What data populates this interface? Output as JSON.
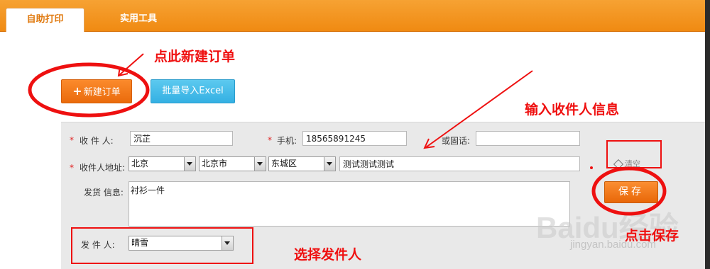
{
  "tabs": [
    {
      "label": "自助打印",
      "active": true
    },
    {
      "label": "实用工具",
      "active": false
    }
  ],
  "toolbar": {
    "new_order_label": "新建订单",
    "new_order_icon": "plus-icon",
    "import_label": "批量导入Excel"
  },
  "form": {
    "recipient_label": "收 件 人:",
    "recipient_value": "沉芷",
    "phone_label": "手机:",
    "phone_value": "18565891245",
    "landline_label": "或固话:",
    "landline_value": "",
    "address_label": "收件人地址:",
    "province": "北京",
    "city": "北京市",
    "district": "东城区",
    "street": "测试测试测试",
    "clear_label": "清空",
    "info_label": "发货  信息:",
    "info_value": "衬衫一件",
    "sender_label": "发  件  人:",
    "sender_value": "晴雪",
    "save_label": "保存"
  },
  "annotations": {
    "new_order": "点此新建订单",
    "input_info": "输入收件人信息",
    "click_save": "点击保存",
    "select_sender": "选择发件人"
  },
  "watermark": {
    "brand": "Baidu经验",
    "url": "jingyan.baidu.com"
  },
  "colors": {
    "topbar": "#f39216",
    "accent_orange": "#ea6b0c",
    "import_blue": "#34b0e3",
    "annotation_red": "#ef1010",
    "form_bg": "#e9e9e9"
  }
}
